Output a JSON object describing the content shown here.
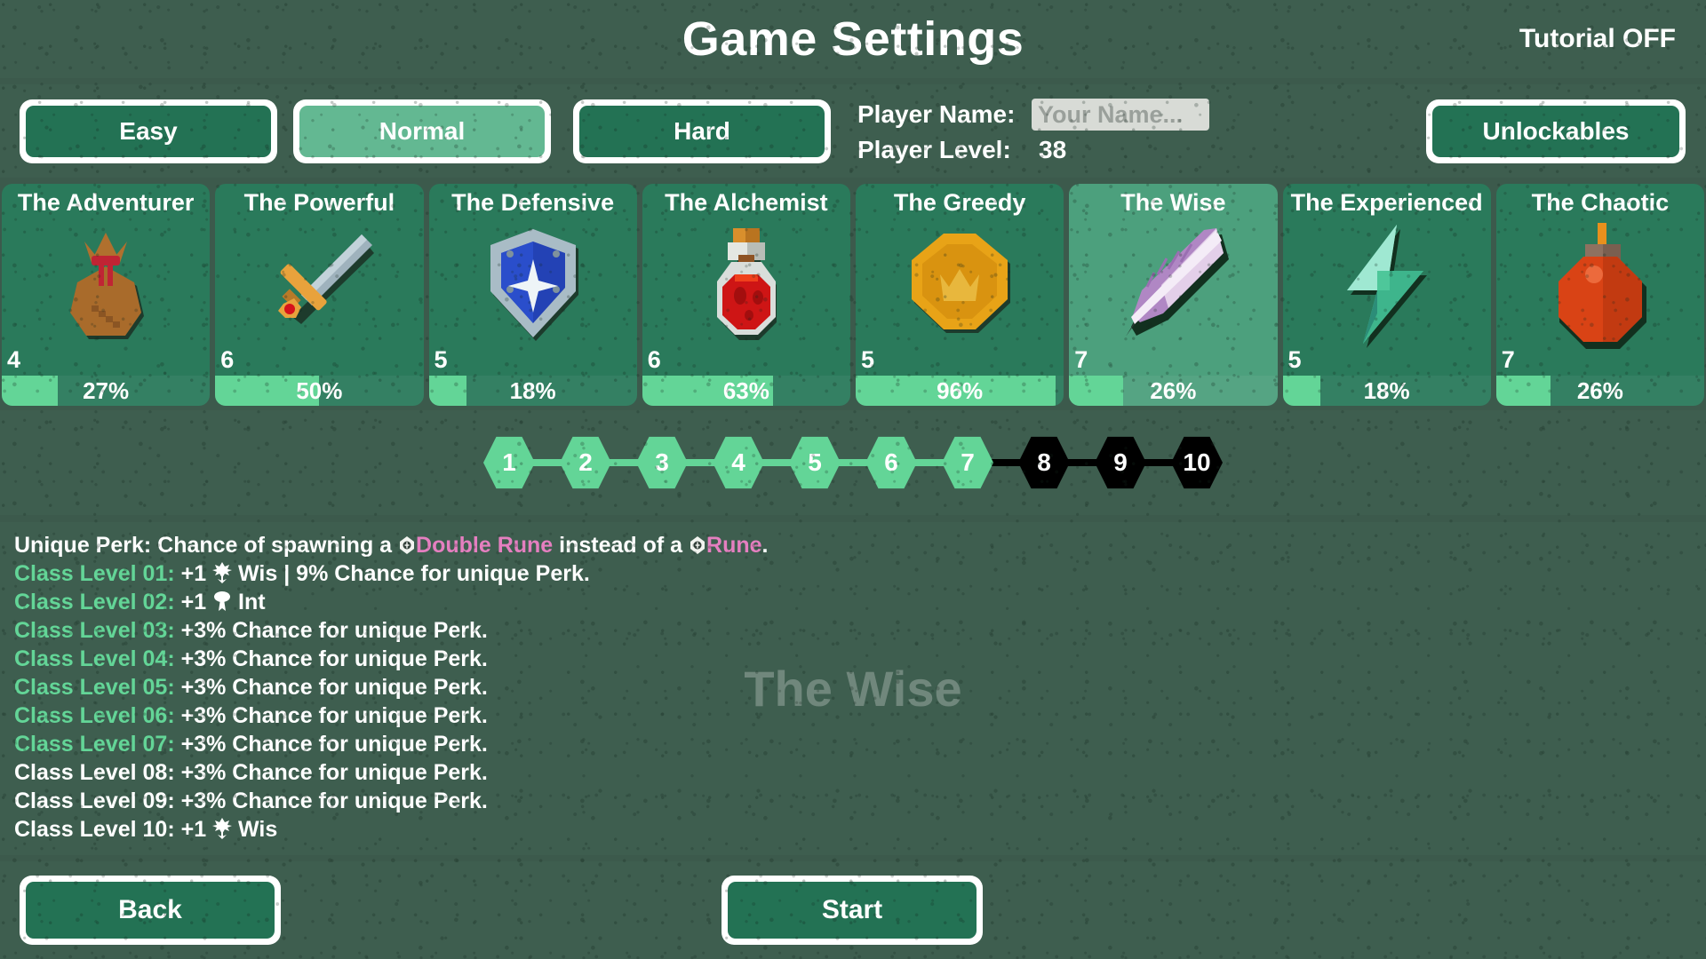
{
  "header": {
    "title": "Game Settings",
    "tutorial": "Tutorial OFF"
  },
  "topbar": {
    "difficulties": [
      {
        "label": "Easy",
        "selected": false
      },
      {
        "label": "Normal",
        "selected": true
      },
      {
        "label": "Hard",
        "selected": false
      }
    ],
    "player_name_label": "Player Name:",
    "player_name_value": "",
    "player_name_placeholder": "Your Name...",
    "player_level_label": "Player Level:",
    "player_level_value": "38",
    "unlockables_label": "Unlockables"
  },
  "classes": [
    {
      "name": "The Adventurer",
      "level": "4",
      "percent": "27%",
      "fill": 27,
      "icon": "moneybag-icon",
      "selected": false
    },
    {
      "name": "The Powerful",
      "level": "6",
      "percent": "50%",
      "fill": 50,
      "icon": "sword-icon",
      "selected": false
    },
    {
      "name": "The Defensive",
      "level": "5",
      "percent": "18%",
      "fill": 18,
      "icon": "shield-icon",
      "selected": false
    },
    {
      "name": "The Alchemist",
      "level": "6",
      "percent": "63%",
      "fill": 63,
      "icon": "potion-icon",
      "selected": false
    },
    {
      "name": "The Greedy",
      "level": "5",
      "percent": "96%",
      "fill": 96,
      "icon": "coin-icon",
      "selected": false
    },
    {
      "name": "The Wise",
      "level": "7",
      "percent": "26%",
      "fill": 26,
      "icon": "feather-icon",
      "selected": true
    },
    {
      "name": "The Experienced",
      "level": "5",
      "percent": "18%",
      "fill": 18,
      "icon": "lightning-icon",
      "selected": false
    },
    {
      "name": "The Chaotic",
      "level": "7",
      "percent": "26%",
      "fill": 26,
      "icon": "bomb-icon",
      "selected": false
    }
  ],
  "level_track": {
    "nodes": [
      {
        "label": "1",
        "unlocked": true
      },
      {
        "label": "2",
        "unlocked": true
      },
      {
        "label": "3",
        "unlocked": true
      },
      {
        "label": "4",
        "unlocked": true
      },
      {
        "label": "5",
        "unlocked": true
      },
      {
        "label": "6",
        "unlocked": true
      },
      {
        "label": "7",
        "unlocked": true
      },
      {
        "label": "8",
        "unlocked": false
      },
      {
        "label": "9",
        "unlocked": false
      },
      {
        "label": "10",
        "unlocked": false
      }
    ]
  },
  "description": {
    "watermark": "The Wise",
    "unique_perk": {
      "prefix": "Unique Perk: Chance of spawning a ",
      "highlight1": "Double Rune",
      "middle": " instead of a ",
      "highlight2": "Rune",
      "suffix": "."
    },
    "levels": [
      {
        "label": "Class Level 01:",
        "text_before_icon": "+1",
        "icon": "wis-icon",
        "text": "Wis | 9% Chance for unique Perk.",
        "unlocked": true
      },
      {
        "label": "Class Level 02:",
        "text_before_icon": "+1",
        "icon": "int-icon",
        "text": "Int",
        "unlocked": true
      },
      {
        "label": "Class Level 03:",
        "text_before_icon": "",
        "icon": "",
        "text": "+3% Chance for unique Perk.",
        "unlocked": true
      },
      {
        "label": "Class Level 04:",
        "text_before_icon": "",
        "icon": "",
        "text": "+3% Chance for unique Perk.",
        "unlocked": true
      },
      {
        "label": "Class Level 05:",
        "text_before_icon": "",
        "icon": "",
        "text": "+3% Chance for unique Perk.",
        "unlocked": true
      },
      {
        "label": "Class Level 06:",
        "text_before_icon": "",
        "icon": "",
        "text": "+3% Chance for unique Perk.",
        "unlocked": true
      },
      {
        "label": "Class Level 07:",
        "text_before_icon": "",
        "icon": "",
        "text": "+3% Chance for unique Perk.",
        "unlocked": true
      },
      {
        "label": "Class Level 08:",
        "text_before_icon": "",
        "icon": "",
        "text": "+3% Chance for unique Perk.",
        "unlocked": false
      },
      {
        "label": "Class Level 09:",
        "text_before_icon": "",
        "icon": "",
        "text": "+3% Chance for unique Perk.",
        "unlocked": false
      },
      {
        "label": "Class Level 10:",
        "text_before_icon": "+1",
        "icon": "wis-icon",
        "text": "Wis",
        "unlocked": false
      }
    ]
  },
  "footer": {
    "back_label": "Back",
    "start_label": "Start"
  },
  "colors": {
    "background": "#3c5a4c",
    "panel": "#3e5e4f",
    "button": "#237254",
    "button_selected": "#63b892",
    "card": "#2a7a5b",
    "card_selected": "#4ca07d",
    "progress": "#63d597",
    "locked": "#000000",
    "rune_highlight": "#e57fc0",
    "level_unlocked_text": "#63d597"
  }
}
